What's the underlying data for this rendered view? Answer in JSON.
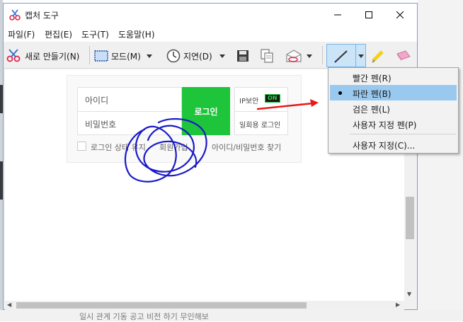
{
  "window": {
    "title": "캡처 도구",
    "controls": [
      "minimize",
      "maximize",
      "close"
    ]
  },
  "menu": {
    "items": [
      "파일(F)",
      "편집(E)",
      "도구(T)",
      "도움말(H)"
    ]
  },
  "toolbar": {
    "new_label": "새로 만들기(N)",
    "new_icon": "scissors-icon",
    "mode_label": "모드(M)",
    "delay_label": "지연(D)",
    "save_icon": "save-icon",
    "copy_icon": "copy-icon",
    "send_icon": "envelope-icon",
    "pen_icon": "pen-icon",
    "highlighter_icon": "highlighter-icon",
    "eraser_icon": "eraser-icon"
  },
  "pen_menu": {
    "items": [
      "빨간 펜(R)",
      "파란 펜(B)",
      "검은 펜(L)",
      "사용자 지정 펜(P)",
      "사용자 지정(C)..."
    ],
    "selected": "파란 펜(B)"
  },
  "capture": {
    "id_label": "아이디",
    "pw_label": "비밀번호",
    "login_button": "로그인",
    "ip_security": "IP보안",
    "ip_status": "ON",
    "otp_login": "일회용 로그인",
    "keep_login": "로그인 상태 유지",
    "signup": "회원가입",
    "find_account": "아이디/비밀번호 찾기"
  },
  "colors": {
    "login_green": "#1ec43a",
    "menu_highlight": "#99c9ef",
    "pen_blue": "#1a1ac8",
    "annotation_red": "#e81818"
  },
  "background": {
    "bottom_snippet": "일시 관계 기동 공고 비전 하기 무인해보"
  }
}
